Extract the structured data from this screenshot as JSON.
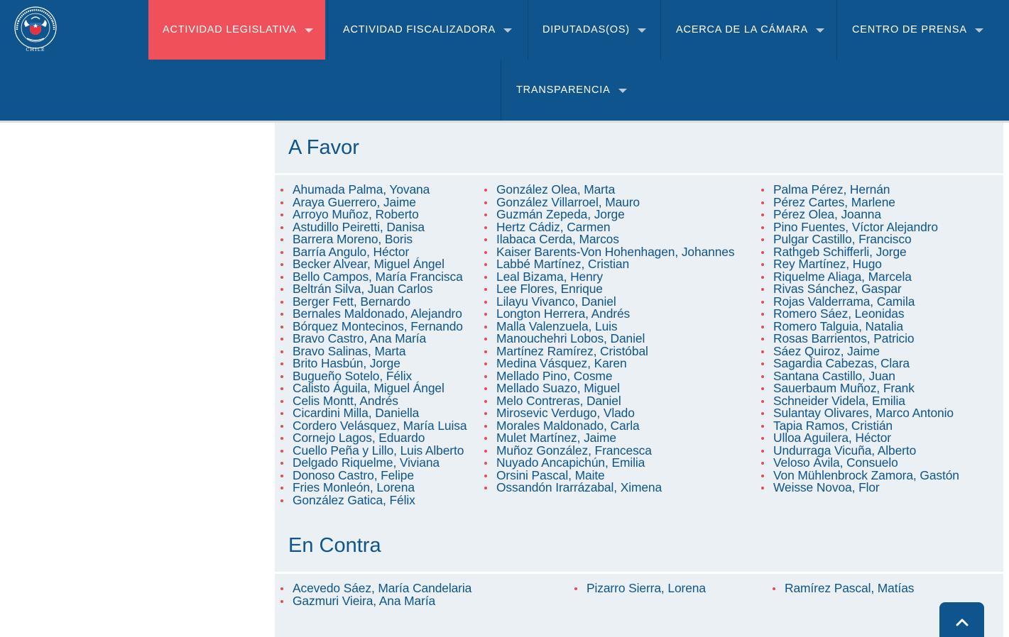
{
  "header": {
    "logo_text": "CÁMARA DE DIPUTADAS Y DIPUTADOS · CHILE",
    "nav": [
      {
        "label": "ACTIVIDAD LEGISLATIVA",
        "icon": "chevron-down-icon",
        "active": true
      },
      {
        "label": "ACTIVIDAD FISCALIZADORA",
        "icon": "chevron-down-icon"
      },
      {
        "label": "DIPUTADAS(OS)",
        "icon": "chevron-down-icon"
      },
      {
        "label": "ACERCA DE LA CÁMARA",
        "icon": "chevron-down-icon"
      },
      {
        "label": "CENTRO DE PRENSA",
        "icon": "chevron-down-icon"
      },
      {
        "label": "TRANSPARENCIA",
        "icon": "chevron-down-icon"
      }
    ]
  },
  "colors": {
    "brand_blue": "#0f548c",
    "accent_red": "#f0505a",
    "bullet_red": "#e84b55",
    "panel_bg": "#eaf0f3"
  },
  "a_favor": {
    "title": "A Favor",
    "columns": [
      [
        "Ahumada Palma, Yovana",
        "Araya Guerrero, Jaime",
        "Arroyo Muñoz, Roberto",
        "Astudillo Peiretti, Danisa",
        "Barrera Moreno, Boris",
        "Barría Angulo, Héctor",
        "Becker Alvear, Miguel Ángel",
        "Bello Campos, María Francisca",
        "Beltrán Silva, Juan Carlos",
        "Berger Fett, Bernardo",
        "Bernales Maldonado, Alejandro",
        "Bórquez Montecinos, Fernando",
        "Bravo Castro, Ana María",
        "Bravo Salinas, Marta",
        "Brito Hasbún, Jorge",
        "Bugueño Sotelo, Félix",
        "Calisto Águila, Miguel Ángel",
        "Celis Montt, Andrés",
        "Cicardini Milla, Daniella",
        "Cordero Velásquez, María Luisa",
        "Cornejo Lagos, Eduardo",
        "Cuello Peña y Lillo, Luis Alberto",
        "Delgado Riquelme, Viviana",
        "Donoso Castro, Felipe",
        "Fries Monleón, Lorena",
        "González Gatica, Félix"
      ],
      [
        "González Olea, Marta",
        "González Villarroel, Mauro",
        "Guzmán Zepeda, Jorge",
        "Hertz Cádiz, Carmen",
        "Ilabaca Cerda, Marcos",
        "Kaiser Barents-Von Hohenhagen, Johannes",
        "Labbé Martínez, Cristian",
        "Leal Bizama, Henry",
        "Lee Flores, Enrique",
        "Lilayu Vivanco, Daniel",
        "Longton Herrera, Andrés",
        "Malla Valenzuela, Luis",
        "Manouchehri Lobos, Daniel",
        "Martínez Ramírez, Cristóbal",
        "Medina Vásquez, Karen",
        "Mellado Pino, Cosme",
        "Mellado Suazo, Miguel",
        "Melo Contreras, Daniel",
        "Mirosevic Verdugo, Vlado",
        "Morales Maldonado, Carla",
        "Mulet Martínez, Jaime",
        "Muñoz González, Francesca",
        "Nuyado Ancapichún, Emilia",
        "Orsini Pascal, Maite",
        "Ossandón Irarrázabal, Ximena"
      ],
      [
        "Palma Pérez, Hernán",
        "Pérez Cartes, Marlene",
        "Pérez Olea, Joanna",
        "Pino Fuentes, Víctor Alejandro",
        "Pulgar Castillo, Francisco",
        "Rathgeb Schifferli, Jorge",
        "Rey Martínez, Hugo",
        "Riquelme Aliaga, Marcela",
        "Rivas Sánchez, Gaspar",
        "Rojas Valderrama, Camila",
        "Romero Sáez, Leonidas",
        "Romero Talguia, Natalia",
        "Rosas Barrientos, Patricio",
        "Sáez Quiroz, Jaime",
        "Sagardia Cabezas, Clara",
        "Santana Castillo, Juan",
        "Sauerbaum Muñoz, Frank",
        "Schneider Videla, Emilia",
        "Sulantay Olivares, Marco Antonio",
        "Tapia Ramos, Cristián",
        "Ulloa Aguilera, Héctor",
        "Undurraga Vicuña, Alberto",
        "Veloso Ávila, Consuelo",
        "Von Mühlenbrock Zamora, Gastón",
        "Weisse Novoa, Flor"
      ]
    ]
  },
  "en_contra": {
    "title": "En Contra",
    "columns": [
      [
        "Acevedo Sáez, María Candelaria",
        "Gazmuri Vieira, Ana María"
      ],
      [
        "Pizarro Sierra, Lorena"
      ],
      [
        "Ramírez Pascal, Matías"
      ]
    ]
  },
  "scroll_top": {
    "icon": "chevron-up-icon"
  }
}
